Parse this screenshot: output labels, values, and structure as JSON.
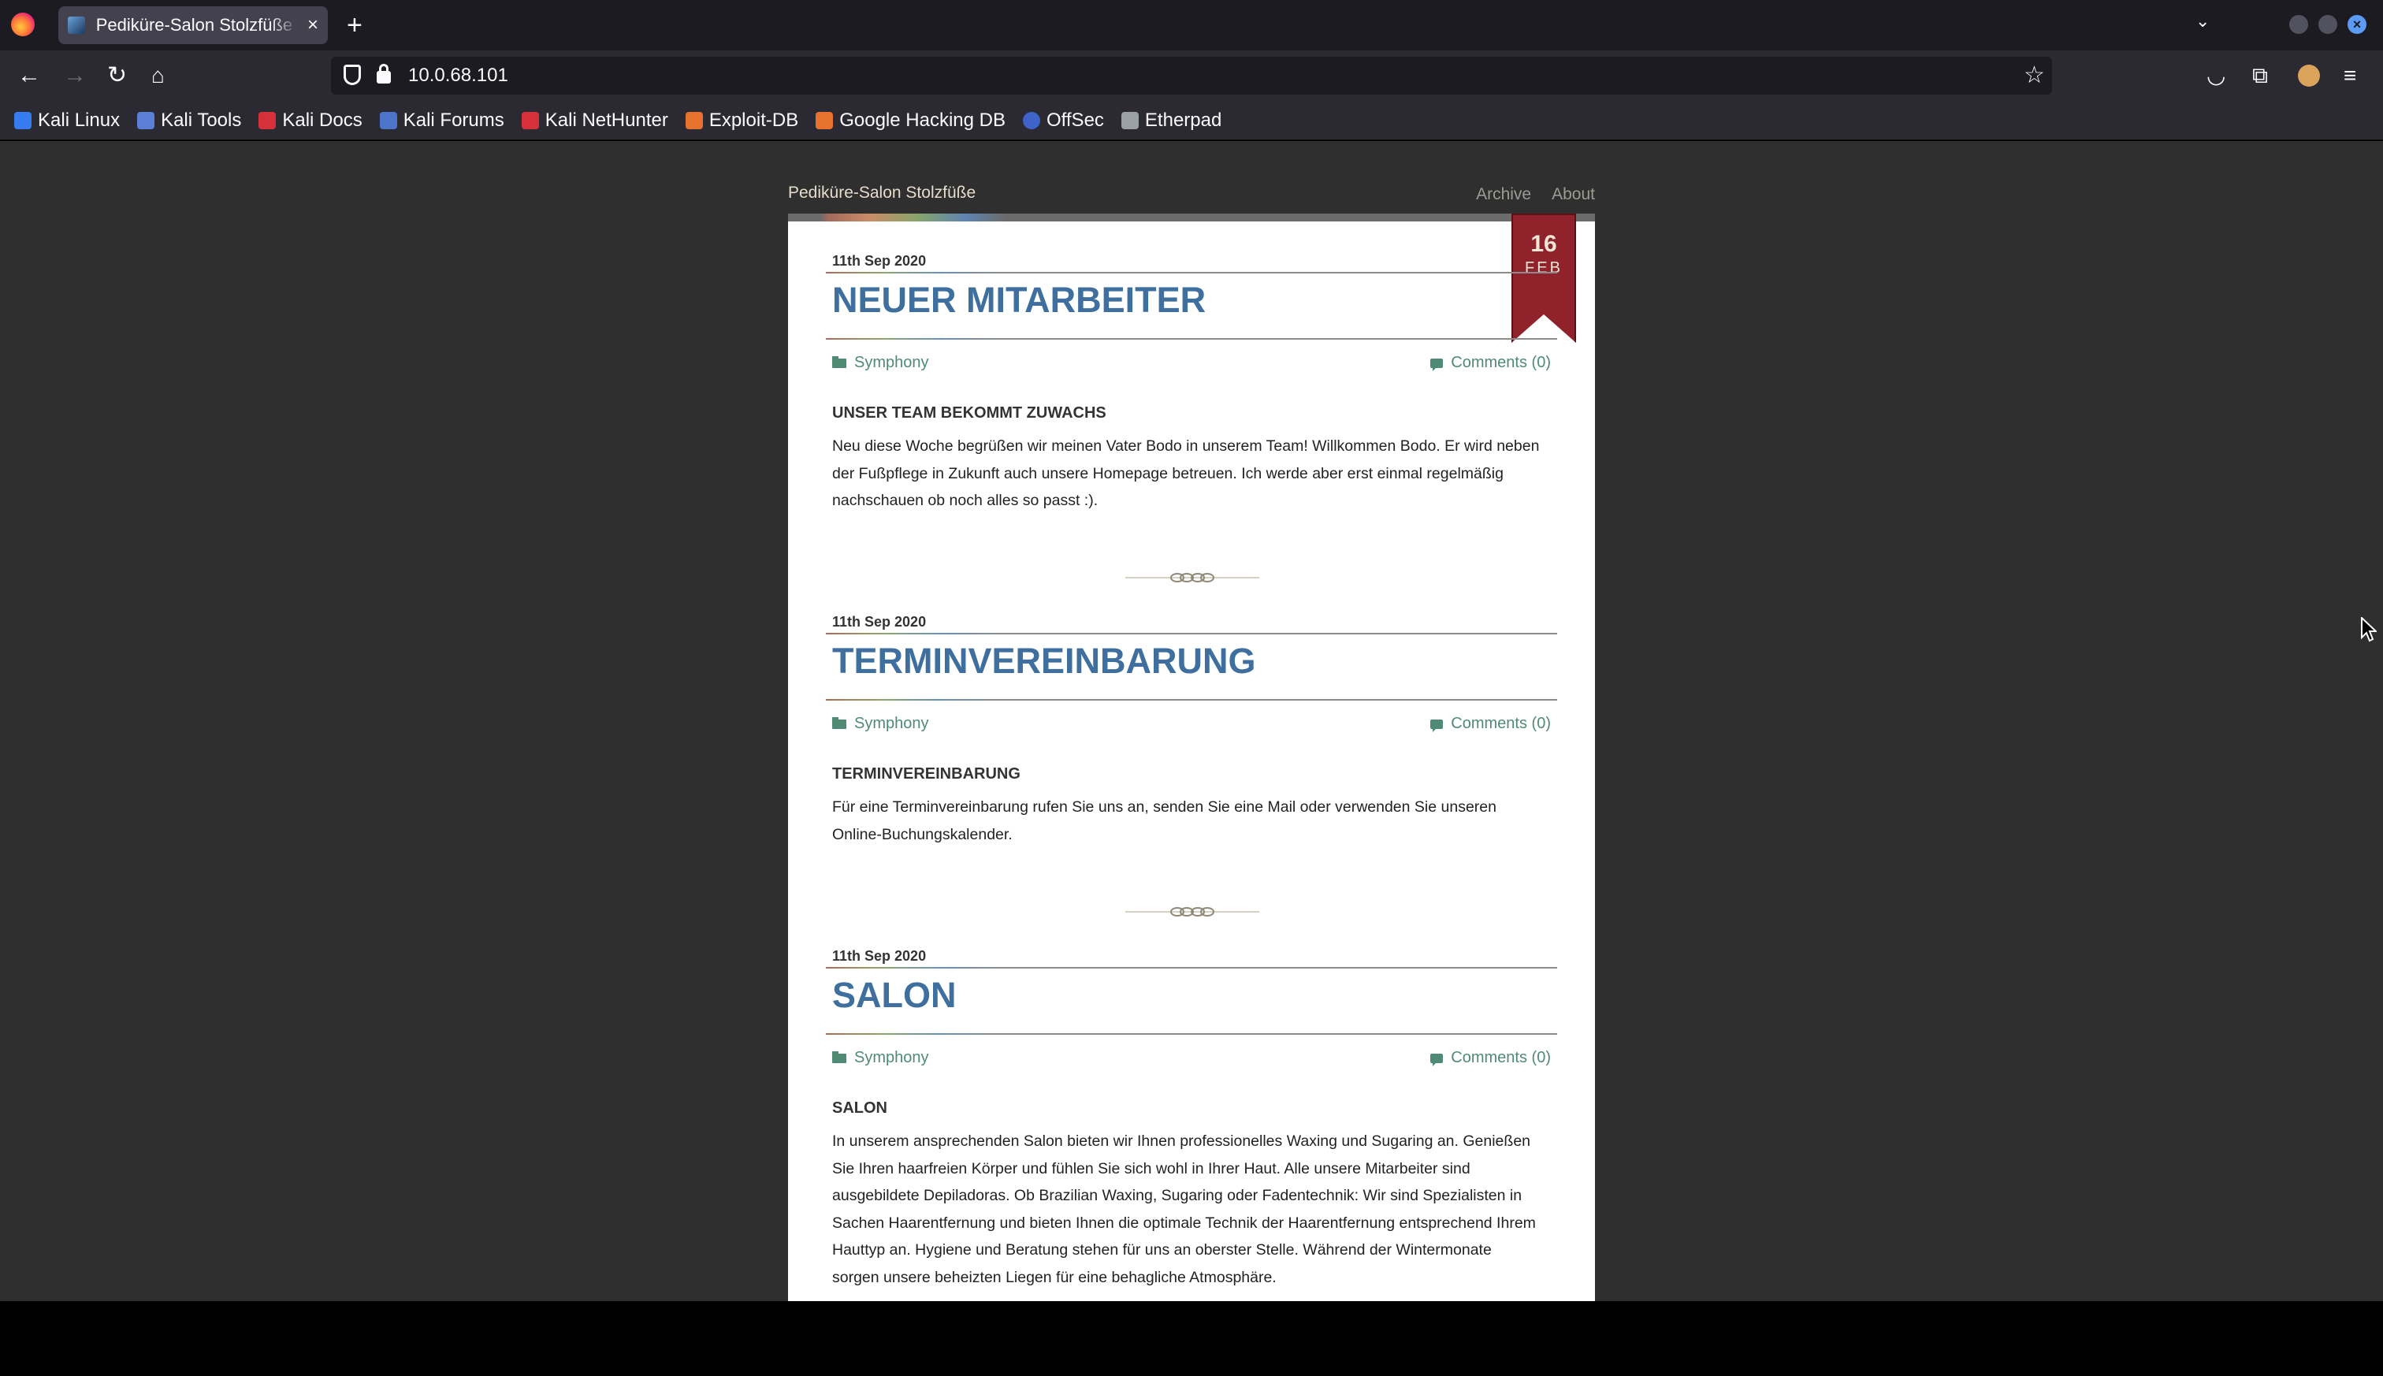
{
  "browser": {
    "tab_title": "Pediküre-Salon Stolzfüße",
    "tab_close": "×",
    "new_tab": "+",
    "url": "10.0.68.101",
    "bookmarks": [
      {
        "label": "Kali Linux",
        "color": "#367bf0"
      },
      {
        "label": "Kali Tools",
        "color": "#5b7fd6"
      },
      {
        "label": "Kali Docs",
        "color": "#d6303a"
      },
      {
        "label": "Kali Forums",
        "color": "#4c74c9"
      },
      {
        "label": "Kali NetHunter",
        "color": "#d6303a"
      },
      {
        "label": "Exploit-DB",
        "color": "#e6722e"
      },
      {
        "label": "Google Hacking DB",
        "color": "#e6722e"
      },
      {
        "label": "OffSec",
        "color": "#3e64c9"
      },
      {
        "label": "Etherpad",
        "color": "#9aa0a6"
      }
    ]
  },
  "site": {
    "title": "Pediküre-Salon Stolzfüße",
    "nav": [
      "Archive",
      "About"
    ],
    "ribbon": {
      "day": "16",
      "month": "FEB"
    }
  },
  "posts": [
    {
      "date": "11th Sep 2020",
      "title": "NEUER MITARBEITER",
      "category": "Symphony",
      "comments": "Comments (0)",
      "subhead": "UNSER TEAM BEKOMMT ZUWACHS",
      "body": "Neu diese Woche begrüßen wir meinen Vater Bodo in unserem Team! Willkommen Bodo. Er wird neben der Fußpflege in Zukunft auch unsere Homepage betreuen. Ich werde aber erst einmal regelmäßig nachschauen ob noch alles so passt :)."
    },
    {
      "date": "11th Sep 2020",
      "title": "TERMINVEREINBARUNG",
      "category": "Symphony",
      "comments": "Comments (0)",
      "subhead": "TERMINVEREINBARUNG",
      "body": "Für eine Terminvereinbarung rufen Sie uns an, senden Sie eine Mail oder verwenden Sie unseren Online-Buchungskalender."
    },
    {
      "date": "11th Sep 2020",
      "title": "SALON",
      "category": "Symphony",
      "comments": "Comments (0)",
      "subhead": "SALON",
      "body": "In unserem ansprechenden Salon bieten wir Ihnen professionelles Waxing und Sugaring an. Genießen Sie Ihren haarfreien Körper und fühlen Sie sich wohl in Ihrer Haut. Alle unsere Mitarbeiter sind ausgebildete Depiladoras. Ob Brazilian Waxing, Sugaring oder Fadentechnik: Wir sind Spezialisten in Sachen Haarentfernung und bieten Ihnen die optimale Technik der Haarentfernung entsprechend Ihrem Hauttyp an. Hygiene und Beratung stehen für uns an oberster Stelle. Während der Wintermonate sorgen unsere beheizten Liegen für eine behagliche Atmosphäre."
    }
  ]
}
